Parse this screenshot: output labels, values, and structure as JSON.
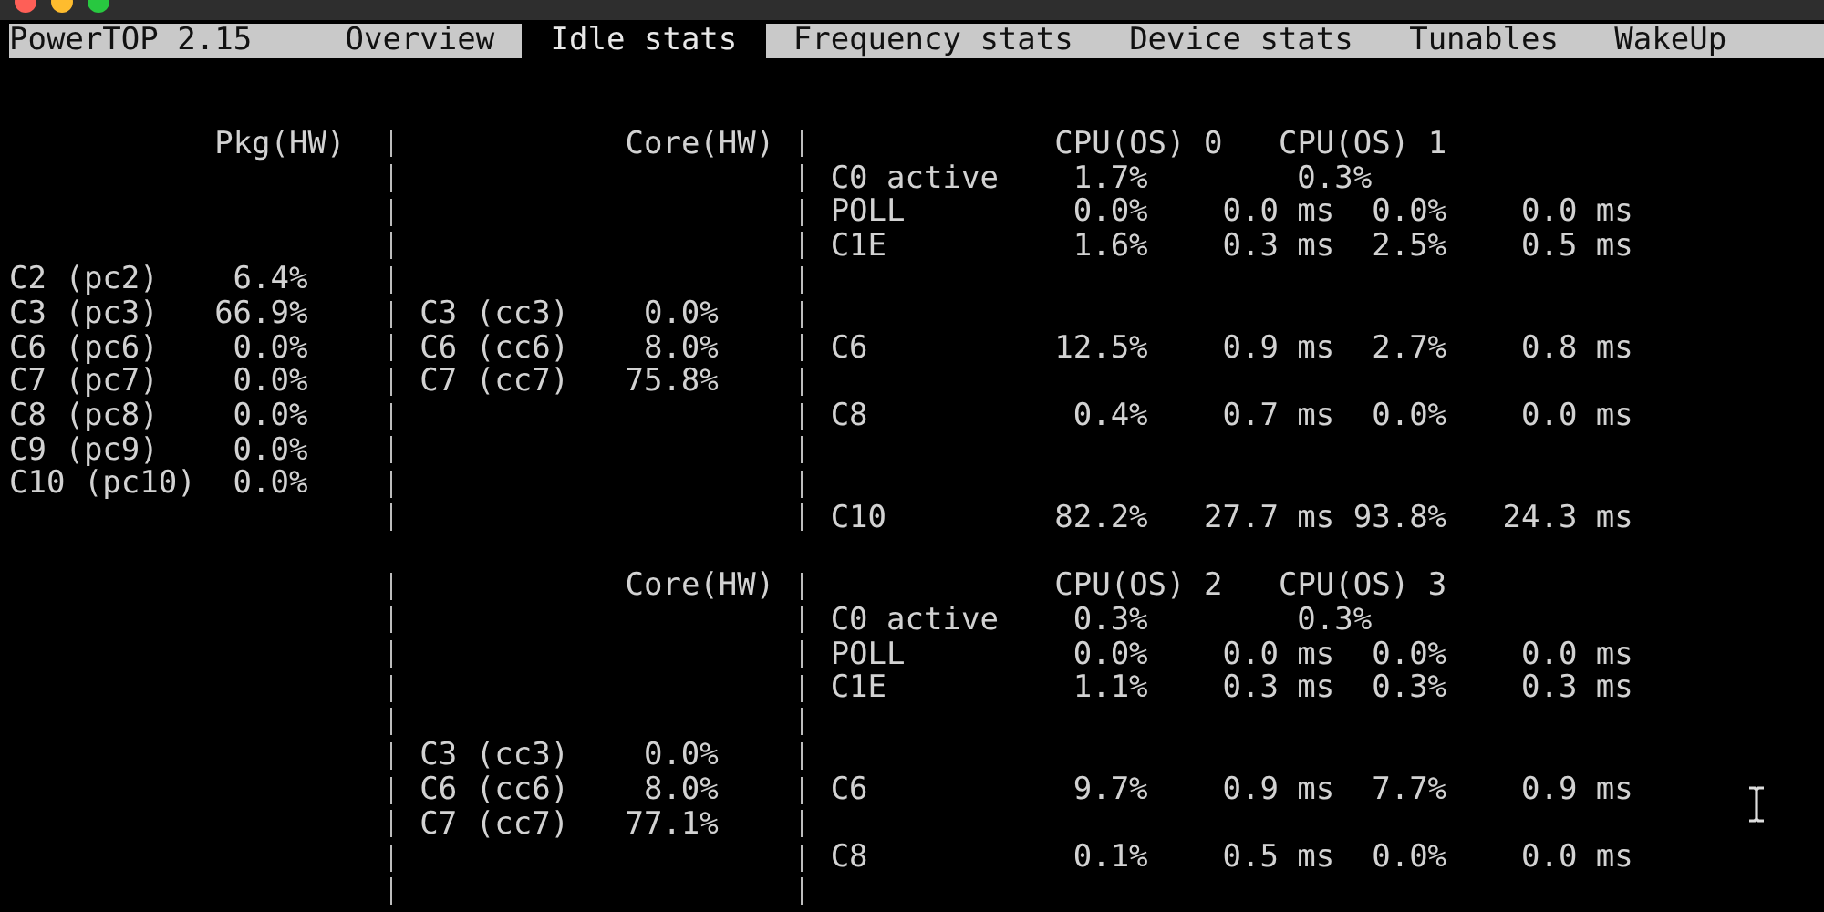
{
  "window": {
    "title": "PowerTOP 2.15"
  },
  "tabs": [
    {
      "label": "Overview",
      "selected": false
    },
    {
      "label": "Idle stats",
      "selected": true
    },
    {
      "label": "Frequency stats",
      "selected": false
    },
    {
      "label": "Device stats",
      "selected": false
    },
    {
      "label": "Tunables",
      "selected": false
    },
    {
      "label": "WakeUp",
      "selected": false
    }
  ],
  "blocks": [
    {
      "pkg_header": "Pkg(HW)",
      "core_header": "Core(HW)",
      "cpu_headers": [
        "CPU(OS) 0",
        "CPU(OS) 1"
      ],
      "rows": [
        {
          "cpu": {
            "kind": "active",
            "label": "C0 active",
            "cells": [
              "1.7%",
              "0.3%"
            ]
          }
        },
        {
          "cpu": {
            "kind": "state",
            "label": "POLL",
            "cells": [
              "0.0%",
              "0.0 ms",
              "0.0%",
              "0.0 ms"
            ]
          }
        },
        {
          "cpu": {
            "kind": "state",
            "label": "C1E",
            "cells": [
              "1.6%",
              "0.3 ms",
              "2.5%",
              "0.5 ms"
            ]
          }
        },
        {
          "pkg": {
            "label": "C2 (pc2)",
            "value": "6.4%"
          }
        },
        {
          "pkg": {
            "label": "C3 (pc3)",
            "value": "66.9%"
          },
          "core": {
            "label": "C3 (cc3)",
            "value": "0.0%"
          }
        },
        {
          "pkg": {
            "label": "C6 (pc6)",
            "value": "0.0%"
          },
          "core": {
            "label": "C6 (cc6)",
            "value": "8.0%"
          },
          "cpu": {
            "kind": "state",
            "label": "C6",
            "cells": [
              "12.5%",
              "0.9 ms",
              "2.7%",
              "0.8 ms"
            ]
          }
        },
        {
          "pkg": {
            "label": "C7 (pc7)",
            "value": "0.0%"
          },
          "core": {
            "label": "C7 (cc7)",
            "value": "75.8%"
          }
        },
        {
          "pkg": {
            "label": "C8 (pc8)",
            "value": "0.0%"
          },
          "cpu": {
            "kind": "state",
            "label": "C8",
            "cells": [
              "0.4%",
              "0.7 ms",
              "0.0%",
              "0.0 ms"
            ]
          }
        },
        {
          "pkg": {
            "label": "C9 (pc9)",
            "value": "0.0%"
          }
        },
        {
          "pkg": {
            "label": "C10 (pc10)",
            "value": "0.0%"
          }
        },
        {
          "cpu": {
            "kind": "state",
            "label": "C10",
            "cells": [
              "82.2%",
              "27.7 ms",
              "93.8%",
              "24.3 ms"
            ]
          }
        }
      ]
    },
    {
      "core_header": "Core(HW)",
      "cpu_headers": [
        "CPU(OS) 2",
        "CPU(OS) 3"
      ],
      "rows": [
        {
          "cpu": {
            "kind": "active",
            "label": "C0 active",
            "cells": [
              "0.3%",
              "0.3%"
            ]
          }
        },
        {
          "cpu": {
            "kind": "state",
            "label": "POLL",
            "cells": [
              "0.0%",
              "0.0 ms",
              "0.0%",
              "0.0 ms"
            ]
          }
        },
        {
          "cpu": {
            "kind": "state",
            "label": "C1E",
            "cells": [
              "1.1%",
              "0.3 ms",
              "0.3%",
              "0.3 ms"
            ]
          }
        },
        {},
        {
          "core": {
            "label": "C3 (cc3)",
            "value": "0.0%"
          }
        },
        {
          "core": {
            "label": "C6 (cc6)",
            "value": "8.0%"
          },
          "cpu": {
            "kind": "state",
            "label": "C6",
            "cells": [
              "9.7%",
              "0.9 ms",
              "7.7%",
              "0.9 ms"
            ]
          }
        },
        {
          "core": {
            "label": "C7 (cc7)",
            "value": "77.1%"
          }
        },
        {
          "cpu": {
            "kind": "state",
            "label": "C8",
            "cells": [
              "0.1%",
              "0.5 ms",
              "0.0%",
              "0.0 ms"
            ]
          }
        },
        {}
      ]
    }
  ]
}
